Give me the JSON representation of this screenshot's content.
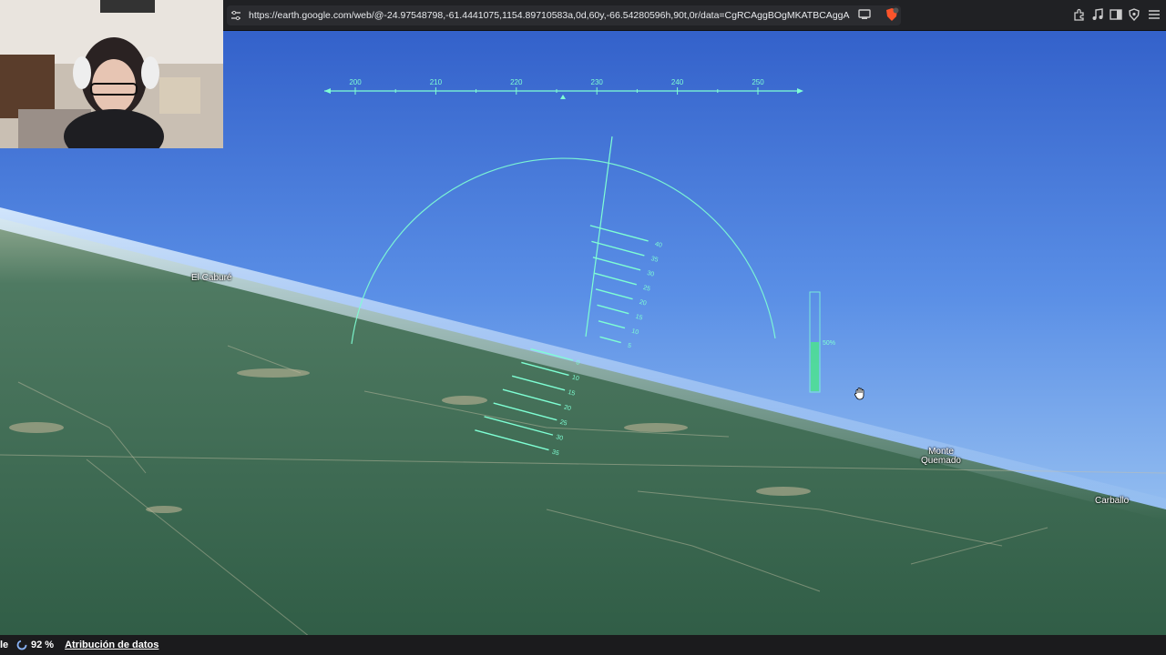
{
  "browser": {
    "url": "https://earth.google.com/web/@-24.97548798,-61.4441075,1154.89710583a,0d,60y,-66.54280596h,90t,0r/data=CgRCAggBOgMKATBCAggASg0I_______..."
  },
  "hud": {
    "heading_ticks": [
      "200",
      "210",
      "220",
      "230",
      "240",
      "250"
    ],
    "pitch_upper": [
      "40",
      "35",
      "30",
      "25",
      "20",
      "15",
      "10",
      "5"
    ],
    "pitch_lower": [
      "0",
      "10",
      "15",
      "20",
      "25",
      "30",
      "35"
    ],
    "throttle_label": "50%",
    "throttle_level": 0.5,
    "color": "#7fffd4"
  },
  "places": {
    "el_cabure": "El Caburé",
    "monte_quemado": "Monte Quemado",
    "carballo": "Carballo"
  },
  "status": {
    "cut_text": "le",
    "zoom": "92 %",
    "attribution": "Atribución de datos"
  }
}
